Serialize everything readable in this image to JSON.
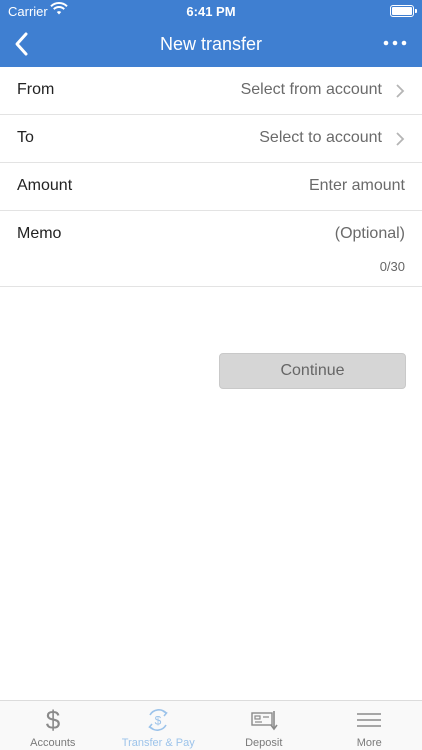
{
  "status_bar": {
    "carrier": "Carrier",
    "time": "6:41 PM"
  },
  "nav": {
    "title": "New transfer",
    "back_icon": "chevron-left-icon",
    "more_icon": "more-dots-icon"
  },
  "form": {
    "from": {
      "label": "From",
      "value": "Select from account"
    },
    "to": {
      "label": "To",
      "value": "Select to account"
    },
    "amount": {
      "label": "Amount",
      "placeholder": "Enter amount"
    },
    "memo": {
      "label": "Memo",
      "placeholder": "(Optional)",
      "counter": "0/30"
    }
  },
  "continue_label": "Continue",
  "tabs": [
    {
      "label": "Accounts",
      "icon": "dollar-icon",
      "active": false
    },
    {
      "label": "Transfer & Pay",
      "icon": "transfer-dollar-icon",
      "active": true
    },
    {
      "label": "Deposit",
      "icon": "deposit-check-icon",
      "active": false
    },
    {
      "label": "More",
      "icon": "menu-lines-icon",
      "active": false
    }
  ],
  "colors": {
    "brand": "#3f7fd1",
    "active_tab": "#9cc3ea",
    "button_disabled": "#d6d6d6"
  }
}
